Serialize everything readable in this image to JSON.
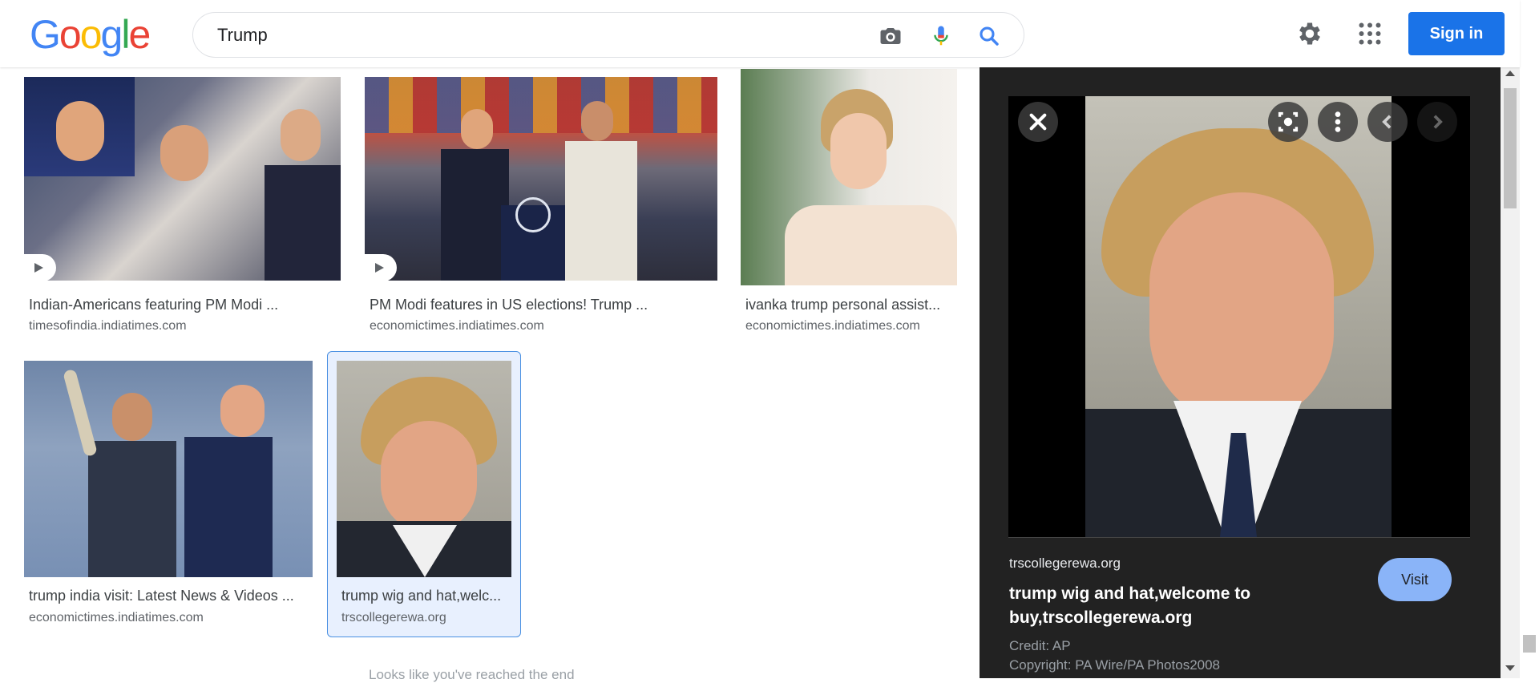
{
  "header": {
    "logo_letters": [
      "G",
      "o",
      "o",
      "g",
      "l",
      "e"
    ],
    "search_value": "Trump",
    "sign_in_label": "Sign in",
    "icons": [
      "camera-icon",
      "microphone-icon",
      "search-icon",
      "gear-icon",
      "apps-grid-icon"
    ]
  },
  "results": [
    {
      "title": "Indian-Americans featuring PM Modi ...",
      "source": "timesofindia.indiatimes.com",
      "is_video": true
    },
    {
      "title": "PM Modi features in US elections! Trump ...",
      "source": "economictimes.indiatimes.com",
      "is_video": true
    },
    {
      "title": "ivanka trump personal assist...",
      "source": "economictimes.indiatimes.com",
      "is_video": false
    },
    {
      "title": "trump india visit: Latest News & Videos ...",
      "source": "economictimes.indiatimes.com",
      "is_video": false
    },
    {
      "title": "trump wig and hat,welc...",
      "source": "trscollegerewa.org",
      "is_video": false,
      "selected": true
    }
  ],
  "footer_hint": "Looks like you've reached the end",
  "panel": {
    "site": "trscollegerewa.org",
    "title": "trump wig and hat,welcome to buy,trscollegerewa.org",
    "visit_label": "Visit",
    "credit": "Credit: AP",
    "copyright": "Copyright: PA Wire/PA Photos2008"
  }
}
